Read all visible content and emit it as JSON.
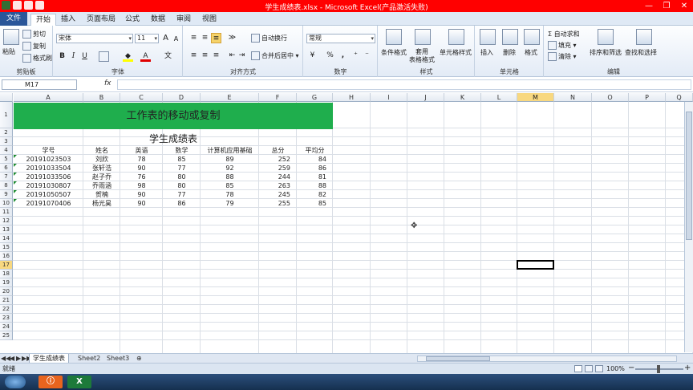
{
  "window": {
    "title": "学生成绩表.xlsx - Microsoft Excel(产品激活失败)",
    "controls": [
      "—",
      "❐",
      "✕"
    ]
  },
  "tabs": [
    {
      "label": "文件"
    },
    {
      "label": "开始"
    },
    {
      "label": "插入"
    },
    {
      "label": "页面布局"
    },
    {
      "label": "公式"
    },
    {
      "label": "数据"
    },
    {
      "label": "审阅"
    },
    {
      "label": "视图"
    }
  ],
  "ribbon": {
    "clipboard": {
      "paste": "粘贴",
      "cut": "剪切",
      "copy": "复制",
      "format_painter": "格式刷",
      "group": "剪贴板"
    },
    "font": {
      "name": "宋体",
      "size": "11",
      "bold": "B",
      "italic": "I",
      "underline": "U",
      "group": "字体",
      "grow": "A",
      "shrink": "A"
    },
    "alignment": {
      "wrap": "自动换行",
      "merge": "合并后居中",
      "group": "对齐方式"
    },
    "number": {
      "format": "常规",
      "percent": "%",
      "comma": ",",
      "group": "数字"
    },
    "styles": {
      "conditional": "条件格式",
      "table": "套用\n表格格式",
      "cell_styles": "单元格样式",
      "group": "样式"
    },
    "cells": {
      "insert": "插入",
      "delete": "删除",
      "format": "格式",
      "group": "单元格"
    },
    "editing": {
      "autosum": "Σ 自动求和",
      "fill": "填充",
      "clear": "清除",
      "sort": "排序和筛选",
      "find": "查找和选择",
      "group": "编辑"
    }
  },
  "formula_bar": {
    "name_box": "M17",
    "fx": "fx",
    "value": ""
  },
  "columns": [
    "A",
    "B",
    "C",
    "D",
    "E",
    "F",
    "G",
    "H",
    "I",
    "J",
    "K",
    "L",
    "M",
    "N",
    "O",
    "P",
    "Q"
  ],
  "selected_column": "M",
  "rows": [
    "1",
    "2",
    "3",
    "4",
    "5",
    "6",
    "7",
    "8",
    "9",
    "10",
    "11",
    "12",
    "13",
    "14",
    "15",
    "16",
    "17",
    "18",
    "19",
    "20",
    "21",
    "22",
    "23",
    "24",
    "25"
  ],
  "selected_row": "17",
  "sheet": {
    "banner": "工作表的移动或复制",
    "title": "学生成绩表",
    "headers": [
      "学号",
      "姓名",
      "英语",
      "数学",
      "计算机应用基础",
      "总分",
      "平均分"
    ],
    "records": [
      [
        "20191023503",
        "刘欣",
        "78",
        "85",
        "89",
        "252",
        "84"
      ],
      [
        "20191033504",
        "张轩浩",
        "90",
        "77",
        "92",
        "259",
        "86"
      ],
      [
        "20191033506",
        "赵子乔",
        "76",
        "80",
        "88",
        "244",
        "81"
      ],
      [
        "20191030807",
        "乔雨涵",
        "98",
        "80",
        "85",
        "263",
        "88"
      ],
      [
        "20191050507",
        "贺楠",
        "90",
        "77",
        "78",
        "245",
        "82"
      ],
      [
        "20191070406",
        "杨光昊",
        "90",
        "86",
        "79",
        "255",
        "85"
      ]
    ]
  },
  "sheet_tabs": [
    {
      "label": "学生成绩表"
    },
    {
      "label": "Sheet2"
    },
    {
      "label": "Sheet3"
    }
  ],
  "sheet_nav": [
    "◀◀",
    "◀",
    "▶",
    "▶▶"
  ],
  "status": {
    "ready": "就绪",
    "zoom": "100%",
    "minus": "−",
    "plus": "+"
  },
  "taskbar": {
    "apps": [
      {
        "label": "ⓘ",
        "color": "#e8641e"
      },
      {
        "label": "X",
        "color": "#1d7a3a"
      }
    ]
  }
}
